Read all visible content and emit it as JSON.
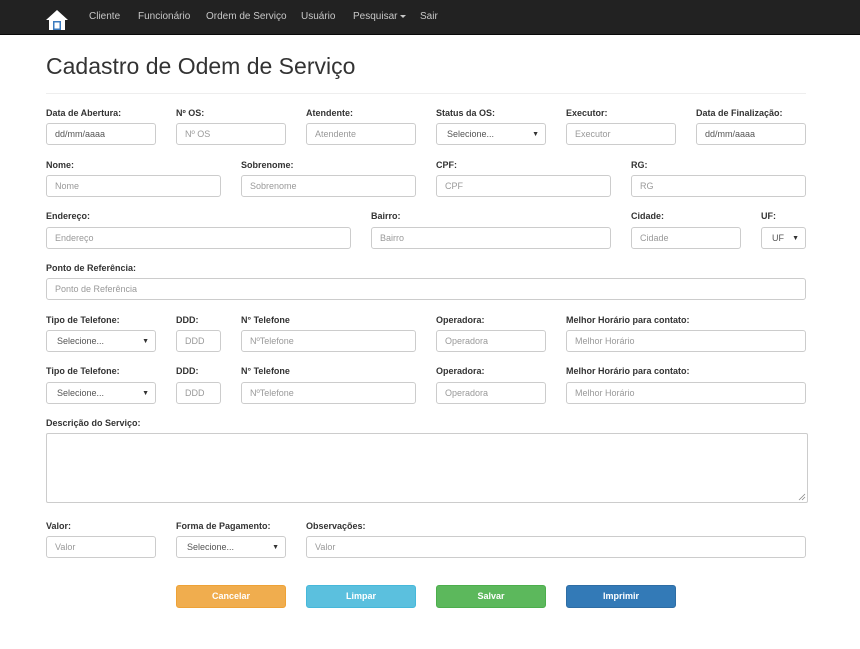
{
  "navbar": {
    "logo_icon": "house-icon",
    "items": [
      "Cliente",
      "Funcionário",
      "Ordem de Serviço",
      "Usuário",
      "Pesquisar",
      "Sair"
    ],
    "background": "#222222"
  },
  "page": {
    "title": "Cadastro de Odem de Serviço"
  },
  "form": {
    "data_abertura": {
      "label": "Data de Abertura:",
      "value": "dd/mm/aaaa"
    },
    "numero_os": {
      "label": "Nº OS:",
      "placeholder": "Nº OS"
    },
    "atendente": {
      "label": "Atendente:",
      "placeholder": "Atendente"
    },
    "status_os": {
      "label": "Status da OS:",
      "value": "Selecione..."
    },
    "executor": {
      "label": "Executor:",
      "placeholder": "Executor"
    },
    "data_finalizacao": {
      "label": "Data de Finalização:",
      "value": "dd/mm/aaaa"
    },
    "nome": {
      "label": "Nome:",
      "placeholder": "Nome"
    },
    "sobrenome": {
      "label": "Sobrenome:",
      "placeholder": "Sobrenome"
    },
    "cpf": {
      "label": "CPF:",
      "placeholder": "CPF"
    },
    "rg": {
      "label": "RG:",
      "placeholder": "RG"
    },
    "endereco": {
      "label": "Endereço:",
      "placeholder": "Endereço"
    },
    "bairro": {
      "label": "Bairro:",
      "placeholder": "Bairro"
    },
    "cidade": {
      "label": "Cidade:",
      "placeholder": "Cidade"
    },
    "uf": {
      "label": "UF:",
      "value": "UF"
    },
    "ponto_referencia": {
      "label": "Ponto de Referência:",
      "placeholder": "Ponto de Referência"
    },
    "phones": [
      {
        "tipo": {
          "label": "Tipo de Telefone:",
          "value": "Selecione..."
        },
        "ddd": {
          "label": "DDD:",
          "placeholder": "DDD"
        },
        "numero": {
          "label": "N° Telefone",
          "placeholder": "NºTelefone"
        },
        "operadora": {
          "label": "Operadora:",
          "placeholder": "Operadora"
        },
        "horario": {
          "label": "Melhor Horário para contato:",
          "placeholder": "Melhor Horário"
        }
      },
      {
        "tipo": {
          "label": "Tipo de Telefone:",
          "value": "Selecione..."
        },
        "ddd": {
          "label": "DDD:",
          "placeholder": "DDD"
        },
        "numero": {
          "label": "N° Telefone",
          "placeholder": "NºTelefone"
        },
        "operadora": {
          "label": "Operadora:",
          "placeholder": "Operadora"
        },
        "horario": {
          "label": "Melhor Horário para contato:",
          "placeholder": "Melhor Horário"
        }
      }
    ],
    "descricao": {
      "label": "Descrição do Serviço:"
    },
    "valor": {
      "label": "Valor:",
      "placeholder": "Valor"
    },
    "forma_pagamento": {
      "label": "Forma de Pagamento:",
      "value": "Selecione..."
    },
    "observacoes": {
      "label": "Observações:",
      "placeholder": "Valor"
    }
  },
  "buttons": {
    "cancelar": {
      "label": "Cancelar",
      "color": "#f0ad4e"
    },
    "limpar": {
      "label": "Limpar",
      "color": "#5bc0de"
    },
    "salvar": {
      "label": "Salvar",
      "color": "#5cb85c"
    },
    "imprimir": {
      "label": "Imprimir",
      "color": "#337ab7"
    }
  }
}
